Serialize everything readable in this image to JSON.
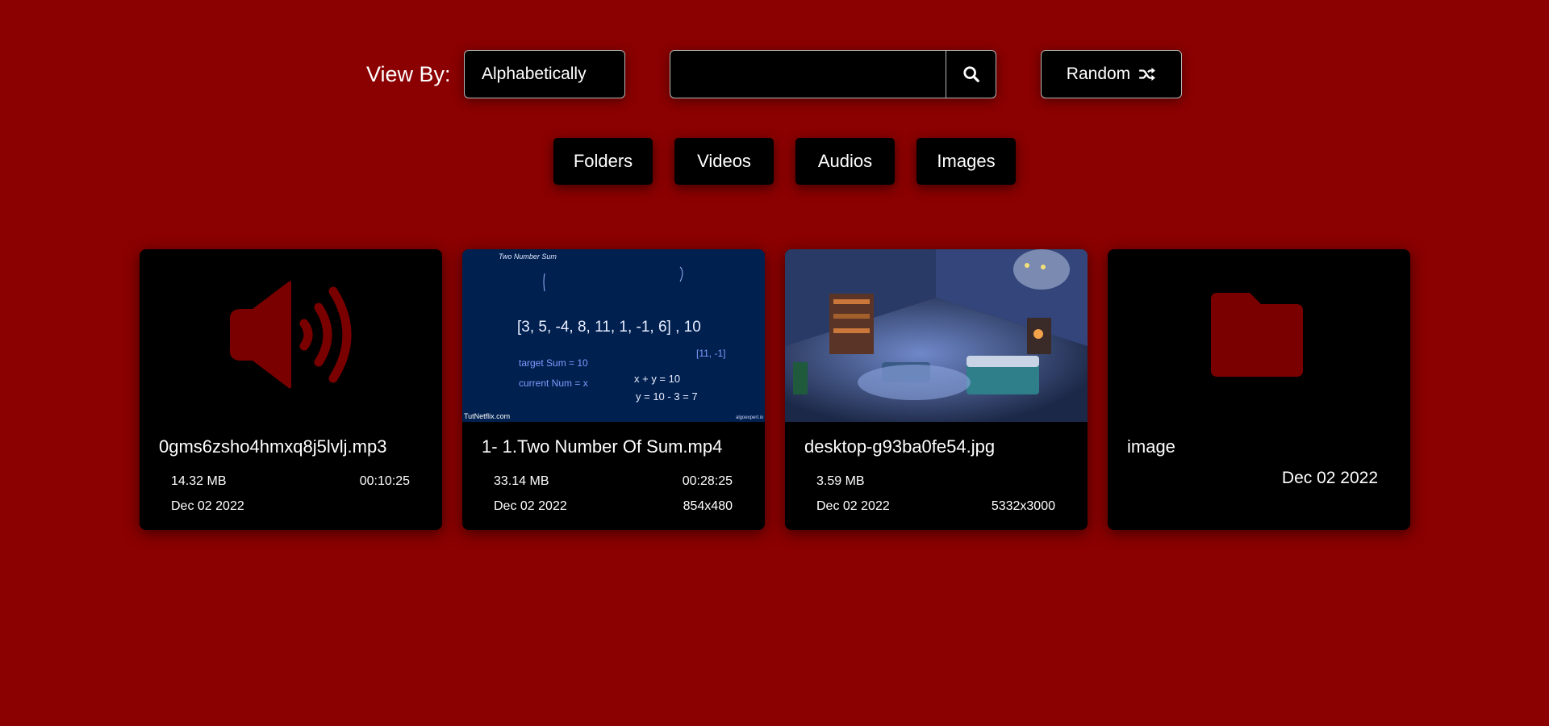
{
  "toolbar": {
    "view_by_label": "View By:",
    "sort_value": "Alphabetically",
    "search_value": "",
    "random_label": "Random"
  },
  "filters": [
    "Folders",
    "Videos",
    "Audios",
    "Images"
  ],
  "cards": [
    {
      "type": "audio",
      "icon": "speaker-icon",
      "title": "0gms6zsho4hmxq8j5lvlj.mp3",
      "size": "14.32 MB",
      "duration": "00:10:25",
      "date": "Dec 02 2022"
    },
    {
      "type": "video",
      "title": "1- 1.Two Number Of Sum.mp4",
      "size": "33.14 MB",
      "duration": "00:28:25",
      "date": "Dec 02 2022",
      "resolution": "854x480",
      "thumb": {
        "heading": "Two Number Sum",
        "array": "[3, 5, -4, 8, 11, 1, -1, 6] , 10",
        "answer": "[11, -1]",
        "line1": "target Sum = 10",
        "line2": "current Num = x",
        "eq1": "x + y = 10",
        "eq2": "y = 10 - 3 = 7",
        "watermark_left": "TutNetflix.com",
        "watermark_right": "algoexpert.io"
      }
    },
    {
      "type": "image",
      "title": "desktop-g93ba0fe54.jpg",
      "size": "3.59 MB",
      "date": "Dec 02 2022",
      "resolution": "5332x3000"
    },
    {
      "type": "folder",
      "icon": "folder-icon",
      "title": "image",
      "date": "Dec 02 2022"
    }
  ],
  "colors": {
    "background": "#8b0000",
    "card": "#000000",
    "icon": "#7a0000"
  }
}
